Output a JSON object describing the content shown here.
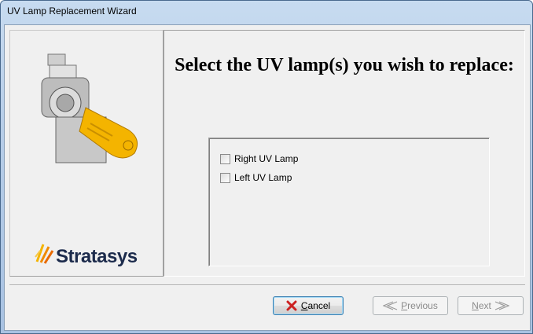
{
  "window": {
    "title": "UV Lamp Replacement Wizard"
  },
  "main": {
    "heading": "Select the UV lamp(s) you wish to replace:",
    "options": [
      {
        "label": "Right UV Lamp",
        "checked": false
      },
      {
        "label": "Left UV Lamp",
        "checked": false
      }
    ]
  },
  "side": {
    "logo_text": "Stratasys",
    "image_icon": "uv-lamp-assembly-icon",
    "logo_icon": "stratasys-logo-icon"
  },
  "buttons": {
    "cancel": {
      "access_key": "C",
      "rest": "ancel",
      "icon": "red-x-icon"
    },
    "previous": {
      "access_key": "P",
      "rest": "revious",
      "icon": "double-chevron-left-icon",
      "enabled": false
    },
    "next": {
      "access_key": "N",
      "rest": "ext",
      "icon": "double-chevron-right-icon",
      "enabled": false
    }
  },
  "colors": {
    "titlebar": "#b6cde8",
    "client": "#f0f0f0",
    "accent_yellow": "#f4b400",
    "logo_navy": "#1c2b4c",
    "cancel_red": "#cc2222"
  }
}
